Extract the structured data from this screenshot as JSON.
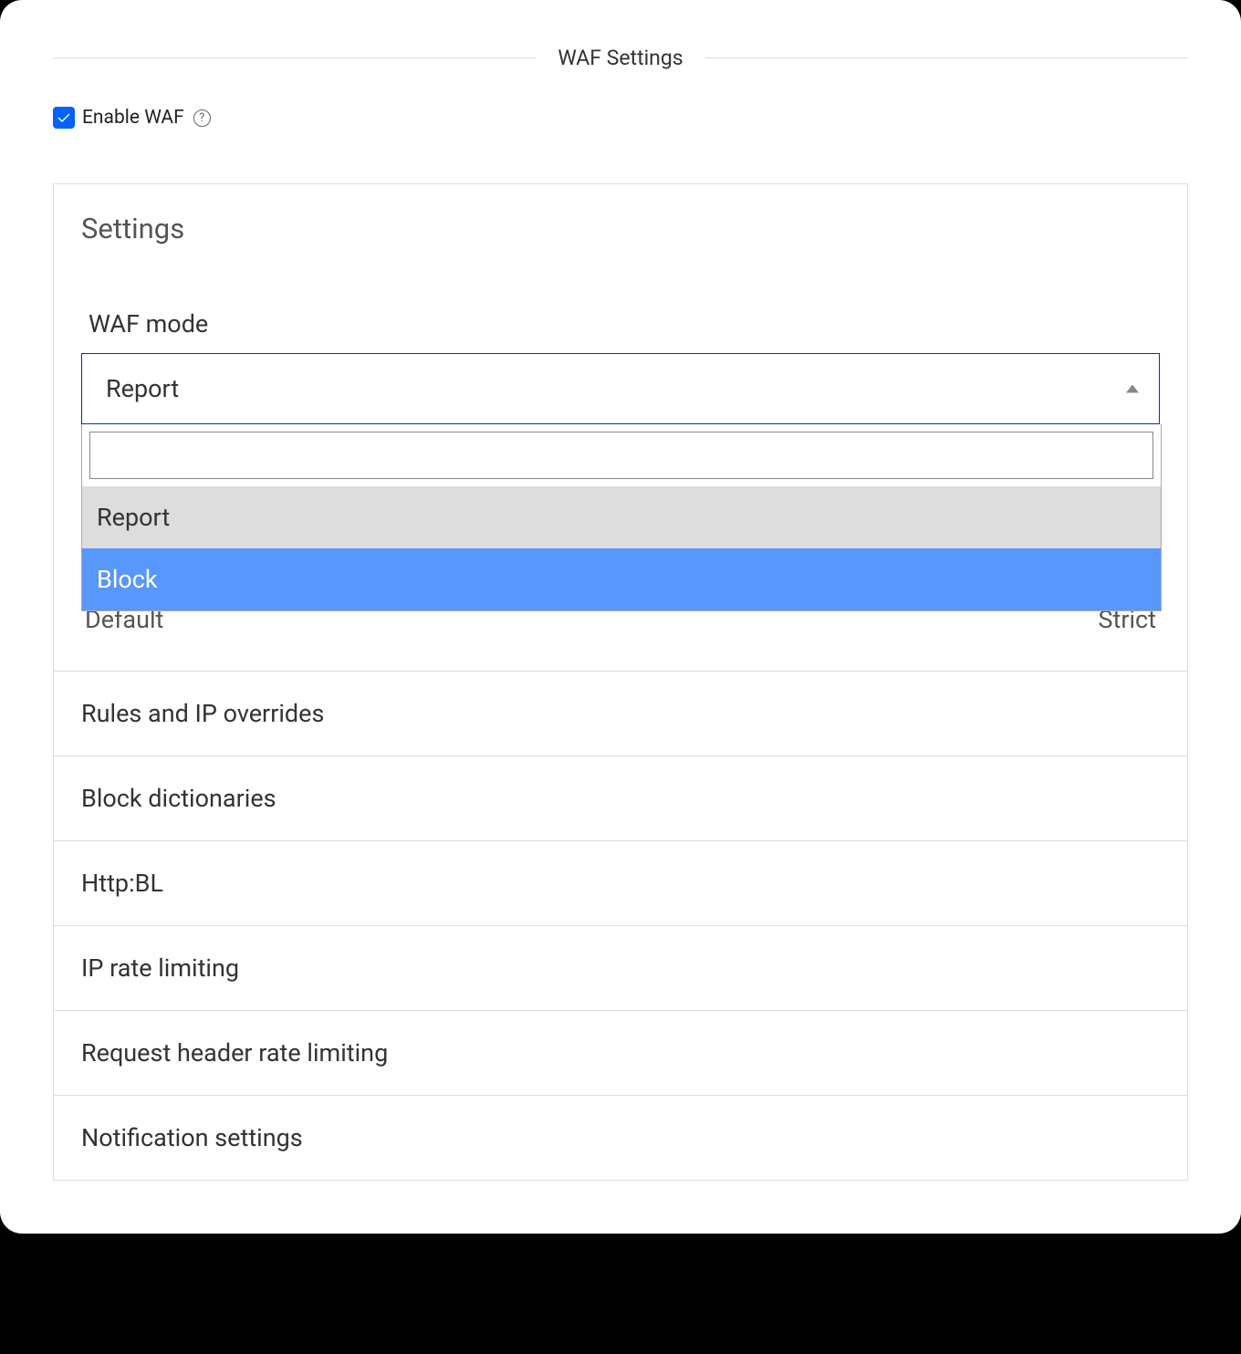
{
  "header": {
    "title": "WAF Settings"
  },
  "enable": {
    "label": "Enable WAF",
    "checked": true
  },
  "settings": {
    "title": "Settings",
    "mode": {
      "label": "WAF mode",
      "selected": "Report",
      "options": [
        "Report",
        "Block"
      ],
      "search_value": ""
    },
    "slider": {
      "left_label": "Default",
      "right_label": "Strict"
    }
  },
  "sections": [
    {
      "label": "Rules and IP overrides"
    },
    {
      "label": "Block dictionaries"
    },
    {
      "label": "Http:BL"
    },
    {
      "label": "IP rate limiting"
    },
    {
      "label": "Request header rate limiting"
    },
    {
      "label": "Notification settings"
    }
  ]
}
